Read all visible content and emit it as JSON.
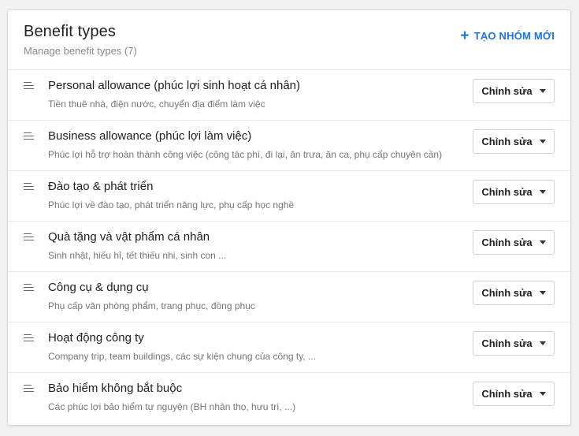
{
  "header": {
    "title": "Benefit types",
    "subtitle": "Manage benefit types (7)",
    "create_label": "TẠO NHÓM MỚI",
    "create_icon": "+"
  },
  "accent_color": "#1a73e8",
  "edit_label": "Chỉnh sửa",
  "items": [
    {
      "title": "Personal allowance (phúc lợi sinh hoạt cá nhân)",
      "desc": "Tiền thuê nhà, điện nước, chuyển địa điểm làm việc"
    },
    {
      "title": "Business allowance (phúc lợi làm việc)",
      "desc": "Phúc lợi hỗ trợ hoàn thành công việc (công tác phí, đi lại, ăn trưa, ăn ca, phụ cấp chuyên cần)"
    },
    {
      "title": "Đào tạo & phát triển",
      "desc": "Phúc lợi về đào tạo, phát triển năng lực, phụ cấp học nghề"
    },
    {
      "title": "Quà tặng và vật phẩm cá nhân",
      "desc": "Sinh nhật, hiếu hỉ, tết thiếu nhi, sinh con ..."
    },
    {
      "title": "Công cụ & dụng cụ",
      "desc": "Phụ cấp văn phòng phẩm, trang phục, đồng phục"
    },
    {
      "title": "Hoạt động công ty",
      "desc": "Company trip, team buildings, các sự kiện chung của công ty, ..."
    },
    {
      "title": "Bảo hiểm không bắt buộc",
      "desc": "Các phúc lợi bảo hiểm tự nguyện (BH nhân thọ, hưu trí, ...)"
    }
  ]
}
